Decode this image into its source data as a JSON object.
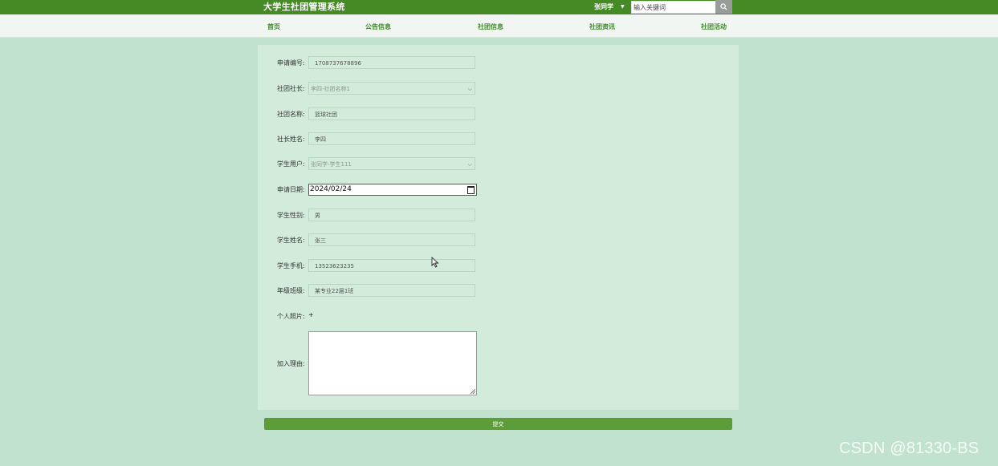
{
  "header": {
    "title": "大学生社团管理系统",
    "user_name": "张同学",
    "search": {
      "placeholder": "输入关键词",
      "value": ""
    },
    "colors": {
      "topbar": "#468a26",
      "nav_text": "#3f8a2c"
    }
  },
  "nav": {
    "items": [
      "首页",
      "公告信息",
      "社团信息",
      "社团资讯",
      "社团活动"
    ]
  },
  "form": {
    "fields": [
      {
        "label": "申请编号:",
        "value": "1708737678896",
        "type": "text"
      },
      {
        "label": "社团社长:",
        "value": "李四-社团名称1",
        "type": "select"
      },
      {
        "label": "社团名称:",
        "value": "篮球社团",
        "type": "text"
      },
      {
        "label": "社长姓名:",
        "value": "李四",
        "type": "text"
      },
      {
        "label": "学生用户:",
        "value": "张同学-学生111",
        "type": "select"
      },
      {
        "label": "申请日期:",
        "value": "2024/02/24",
        "type": "date"
      },
      {
        "label": "学生性别:",
        "value": "男",
        "type": "text"
      },
      {
        "label": "学生姓名:",
        "value": "张三",
        "type": "text"
      },
      {
        "label": "学生手机:",
        "value": "13523623235",
        "type": "text"
      },
      {
        "label": "年级班级:",
        "value": "某专业22届1班",
        "type": "text"
      }
    ],
    "photo_label": "个人照片:",
    "photo_add": "+",
    "reason_label": "加入理由:",
    "reason_value": "",
    "submit_label": "提交"
  },
  "watermark": "CSDN @81330-BS"
}
